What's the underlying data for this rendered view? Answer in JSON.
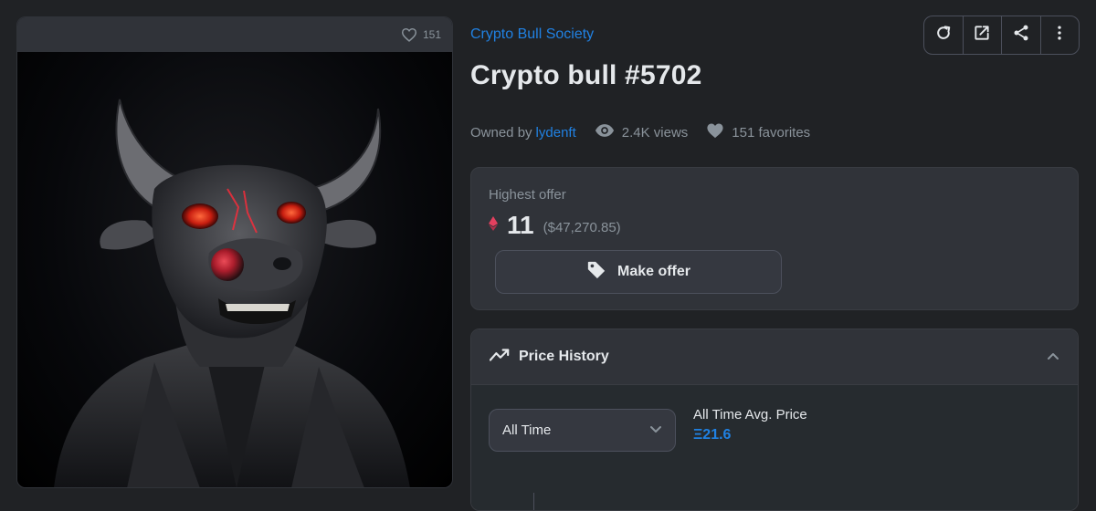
{
  "media": {
    "favorite_count": "151",
    "icons": {
      "favorite": "heart-outline-icon"
    },
    "artwork_description_icon": "bull-artwork"
  },
  "item": {
    "collection": "Crypto Bull Society",
    "title": "Crypto bull #5702",
    "owned_by_prefix": "Owned by",
    "owner": "lydenft",
    "views": "2.4K views",
    "favorites": "151 favorites"
  },
  "toolbar": {
    "icons": [
      "refresh-icon",
      "external-link-icon",
      "share-icon",
      "more-vertical-icon"
    ]
  },
  "offer": {
    "label": "Highest offer",
    "amount": "11",
    "usd": "($47,270.85)",
    "button_label": "Make offer",
    "currency_icon": "ethereum-icon"
  },
  "price_history": {
    "title": "Price History",
    "range_selected": "All Time",
    "avg_label": "All Time Avg. Price",
    "avg_value": "Ξ21.6"
  },
  "colors": {
    "accent": "#2081e2",
    "panel": "#303339",
    "background": "#202225",
    "eth_pink": "#e4405f"
  }
}
